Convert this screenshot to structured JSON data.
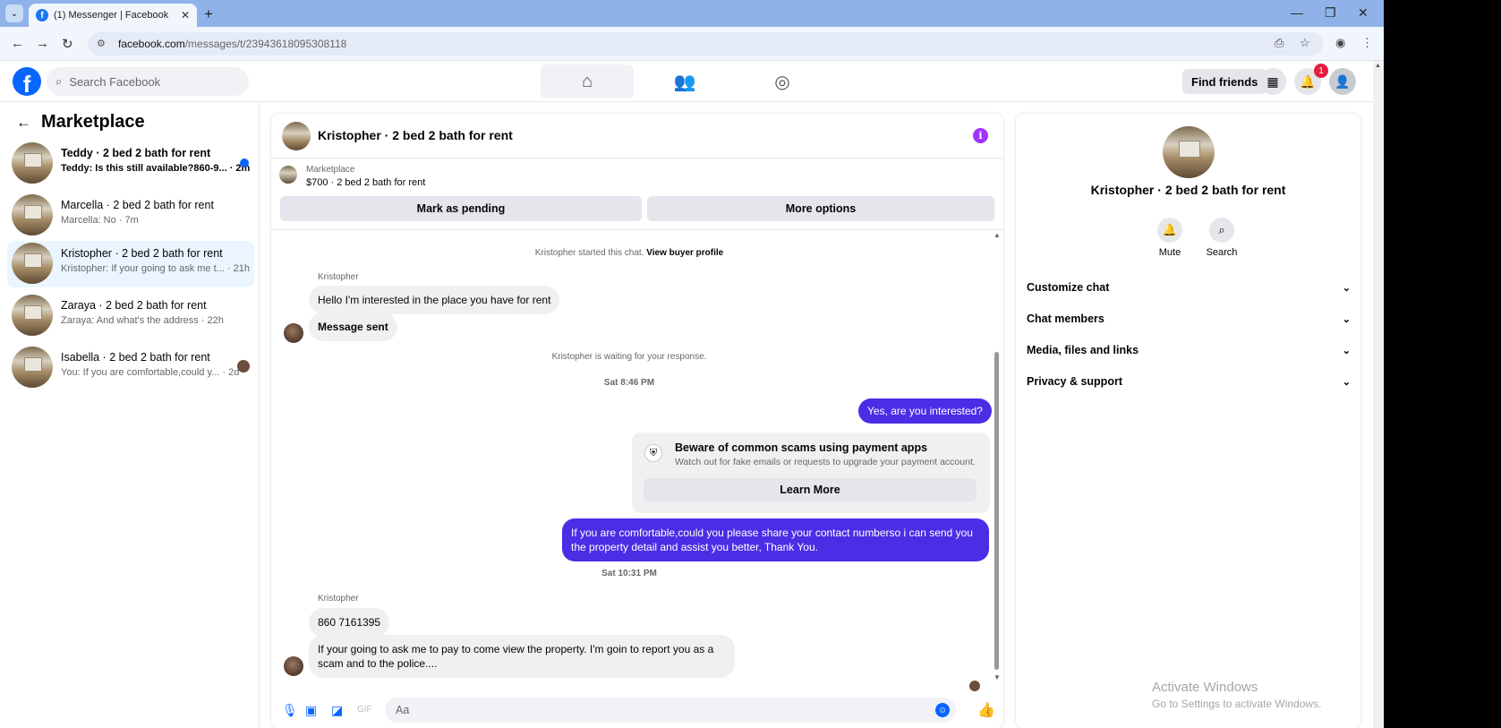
{
  "browser": {
    "tab_title": "(1) Messenger | Facebook",
    "url_host": "facebook.com",
    "url_path": "/messages/t/23943618095308118"
  },
  "header": {
    "search_placeholder": "Search Facebook",
    "find_friends": "Find friends",
    "notification_count": "1"
  },
  "sidebar": {
    "title": "Marketplace",
    "conversations": [
      {
        "name": "Teddy · 2 bed 2 bath for rent",
        "snippet": "Teddy: Is this still available?860-9... · 2m"
      },
      {
        "name": "Marcella · 2 bed 2 bath for rent",
        "snippet": "Marcella: No · 7m"
      },
      {
        "name": "Kristopher · 2 bed 2 bath for rent",
        "snippet": "Kristopher: If your going to ask me t...  · 21h"
      },
      {
        "name": "Zaraya · 2 bed 2 bath for rent",
        "snippet": "Zaraya: And what's the address · 22h"
      },
      {
        "name": "Isabella · 2 bed 2 bath for rent",
        "snippet": "You: If you are comfortable,could y...  · 2d"
      }
    ]
  },
  "chat": {
    "title": "Kristopher · 2 bed 2 bath for rent",
    "listing_source": "Marketplace",
    "listing_price": "$700 · 2 bed 2 bath for rent",
    "mark_pending": "Mark as pending",
    "more_options": "More options",
    "started_text": "Kristopher started this chat.",
    "view_profile": "View buyer profile",
    "sender_name_1": "Kristopher",
    "msg_in_1": "Hello I'm interested in the place you have for rent",
    "msg_in_2": "Message sent",
    "waiting_text": "Kristopher is waiting for your response.",
    "time_1": "Sat 8:46 PM",
    "msg_out_1": "Yes, are you interested?",
    "scam_title": "Beware of common scams using payment apps",
    "scam_desc": "Watch out for fake emails or requests to upgrade your payment account.",
    "learn_more": "Learn More",
    "msg_out_2": "If you are comfortable,could you please share your contact numberso i can send you the property detail and assist you better, Thank You.",
    "time_2": "Sat 10:31 PM",
    "sender_name_2": "Kristopher",
    "msg_in_3": "860 7161395",
    "msg_in_4": "If your going to ask me to pay to come view the property. I'm goin to report you as a scam and to the police....",
    "composer_placeholder": "Aa"
  },
  "details": {
    "name": "Kristopher · 2 bed 2 bath for rent",
    "mute": "Mute",
    "search": "Search",
    "sections": [
      "Customize chat",
      "Chat members",
      "Media, files and links",
      "Privacy & support"
    ]
  },
  "watermark": {
    "line1": "Activate Windows",
    "line2": "Go to Settings to activate Windows."
  },
  "colors": {
    "accent": "#0866ff",
    "outgoing_bubble": "#4a2ee6"
  }
}
